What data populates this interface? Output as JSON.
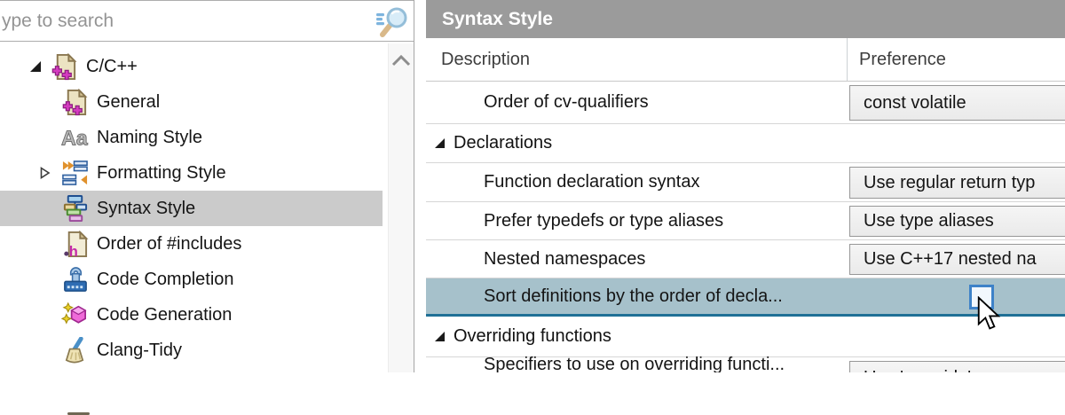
{
  "search": {
    "placeholder": "ype to search",
    "icon": "search-filter-icon"
  },
  "sidebar": {
    "items": [
      {
        "label": "C/C++",
        "icon": "cpp-document-icon",
        "state": "expanded",
        "level": 0,
        "selected": false
      },
      {
        "label": "General",
        "icon": "general-document-icon",
        "state": "none",
        "level": 1,
        "selected": false
      },
      {
        "label": "Naming Style",
        "icon": "naming-style-icon",
        "state": "none",
        "level": 1,
        "selected": false
      },
      {
        "label": "Formatting Style",
        "icon": "formatting-style-icon",
        "state": "collapsed",
        "level": 1,
        "selected": false
      },
      {
        "label": "Syntax Style",
        "icon": "syntax-style-icon",
        "state": "none",
        "level": 1,
        "selected": true
      },
      {
        "label": "Order of #includes",
        "icon": "includes-order-icon",
        "state": "none",
        "level": 1,
        "selected": false
      },
      {
        "label": "Code Completion",
        "icon": "code-completion-icon",
        "state": "none",
        "level": 1,
        "selected": false
      },
      {
        "label": "Code Generation",
        "icon": "code-generation-icon",
        "state": "none",
        "level": 1,
        "selected": false
      },
      {
        "label": "Clang-Tidy",
        "icon": "clang-tidy-icon",
        "state": "none",
        "level": 1,
        "selected": false
      }
    ],
    "scrollbar": {
      "up_icon": "chevron-up-icon"
    }
  },
  "panel": {
    "title": "Syntax Style",
    "table": {
      "columns": [
        "Description",
        "Preference"
      ],
      "rows": [
        {
          "description": "Order of cv-qualifiers",
          "preference": "const volatile",
          "control": "dropdown"
        },
        {
          "description": "Declarations",
          "control": "group",
          "state": "expanded"
        },
        {
          "description": "Function declaration syntax",
          "preference": "Use regular return typ",
          "control": "dropdown"
        },
        {
          "description": "Prefer typedefs or type aliases",
          "preference": "Use type aliases",
          "control": "dropdown"
        },
        {
          "description": "Nested namespaces",
          "preference": "Use C++17 nested na",
          "control": "dropdown"
        },
        {
          "description": "Sort definitions by the order of decla...",
          "control": "checkbox",
          "checked": false,
          "highlighted": true
        },
        {
          "description": "Overriding functions",
          "control": "group",
          "state": "expanded"
        },
        {
          "description": "Specifiers to use on overriding functi...",
          "preference": "Use 'override'",
          "control": "dropdown"
        }
      ]
    }
  },
  "colors": {
    "title_bar": "#9b9b9b",
    "tree_selection": "#cbcbcb",
    "row_highlight": "#a6c1cb",
    "row_highlight_border": "#1f7096",
    "checkbox_border": "#3e82c8",
    "separator": "#d6d6d6"
  }
}
